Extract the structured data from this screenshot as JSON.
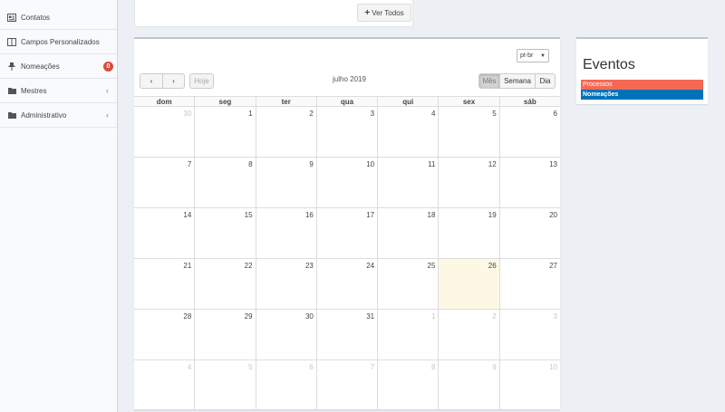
{
  "sidebar": {
    "items": [
      {
        "label": "Contatos",
        "icon": "address-card-icon"
      },
      {
        "label": "Campos Personalizados",
        "icon": "columns-icon"
      },
      {
        "label": "Nomeações",
        "icon": "pin-icon",
        "badge": "0"
      },
      {
        "label": "Mestres",
        "icon": "folder-icon",
        "chevron": "‹"
      },
      {
        "label": "Administrativo",
        "icon": "folder-icon",
        "chevron": "‹"
      }
    ]
  },
  "top": {
    "ver_todos": "Ver Todos"
  },
  "calendar": {
    "language": "pt-br",
    "title": "julho 2019",
    "buttons": {
      "prev": "‹",
      "next": "›",
      "today": "Hoje",
      "month": "Mês",
      "week": "Semana",
      "day": "Dia"
    },
    "weekdays": [
      "dom",
      "seg",
      "ter",
      "qua",
      "qui",
      "sex",
      "sáb"
    ],
    "weeks": [
      [
        "30",
        "1",
        "2",
        "3",
        "4",
        "5",
        "6"
      ],
      [
        "7",
        "8",
        "9",
        "10",
        "11",
        "12",
        "13"
      ],
      [
        "14",
        "15",
        "16",
        "17",
        "18",
        "19",
        "20"
      ],
      [
        "21",
        "22",
        "23",
        "24",
        "25",
        "26",
        "27"
      ],
      [
        "28",
        "29",
        "30",
        "31",
        "1",
        "2",
        "3"
      ],
      [
        "4",
        "5",
        "6",
        "7",
        "8",
        "9",
        "10"
      ]
    ],
    "today": "26"
  },
  "eventos": {
    "title": "Eventos",
    "items": [
      {
        "label": "Processos",
        "color": "#f56954"
      },
      {
        "label": "Nomeações",
        "color": "#0073b7"
      }
    ]
  }
}
